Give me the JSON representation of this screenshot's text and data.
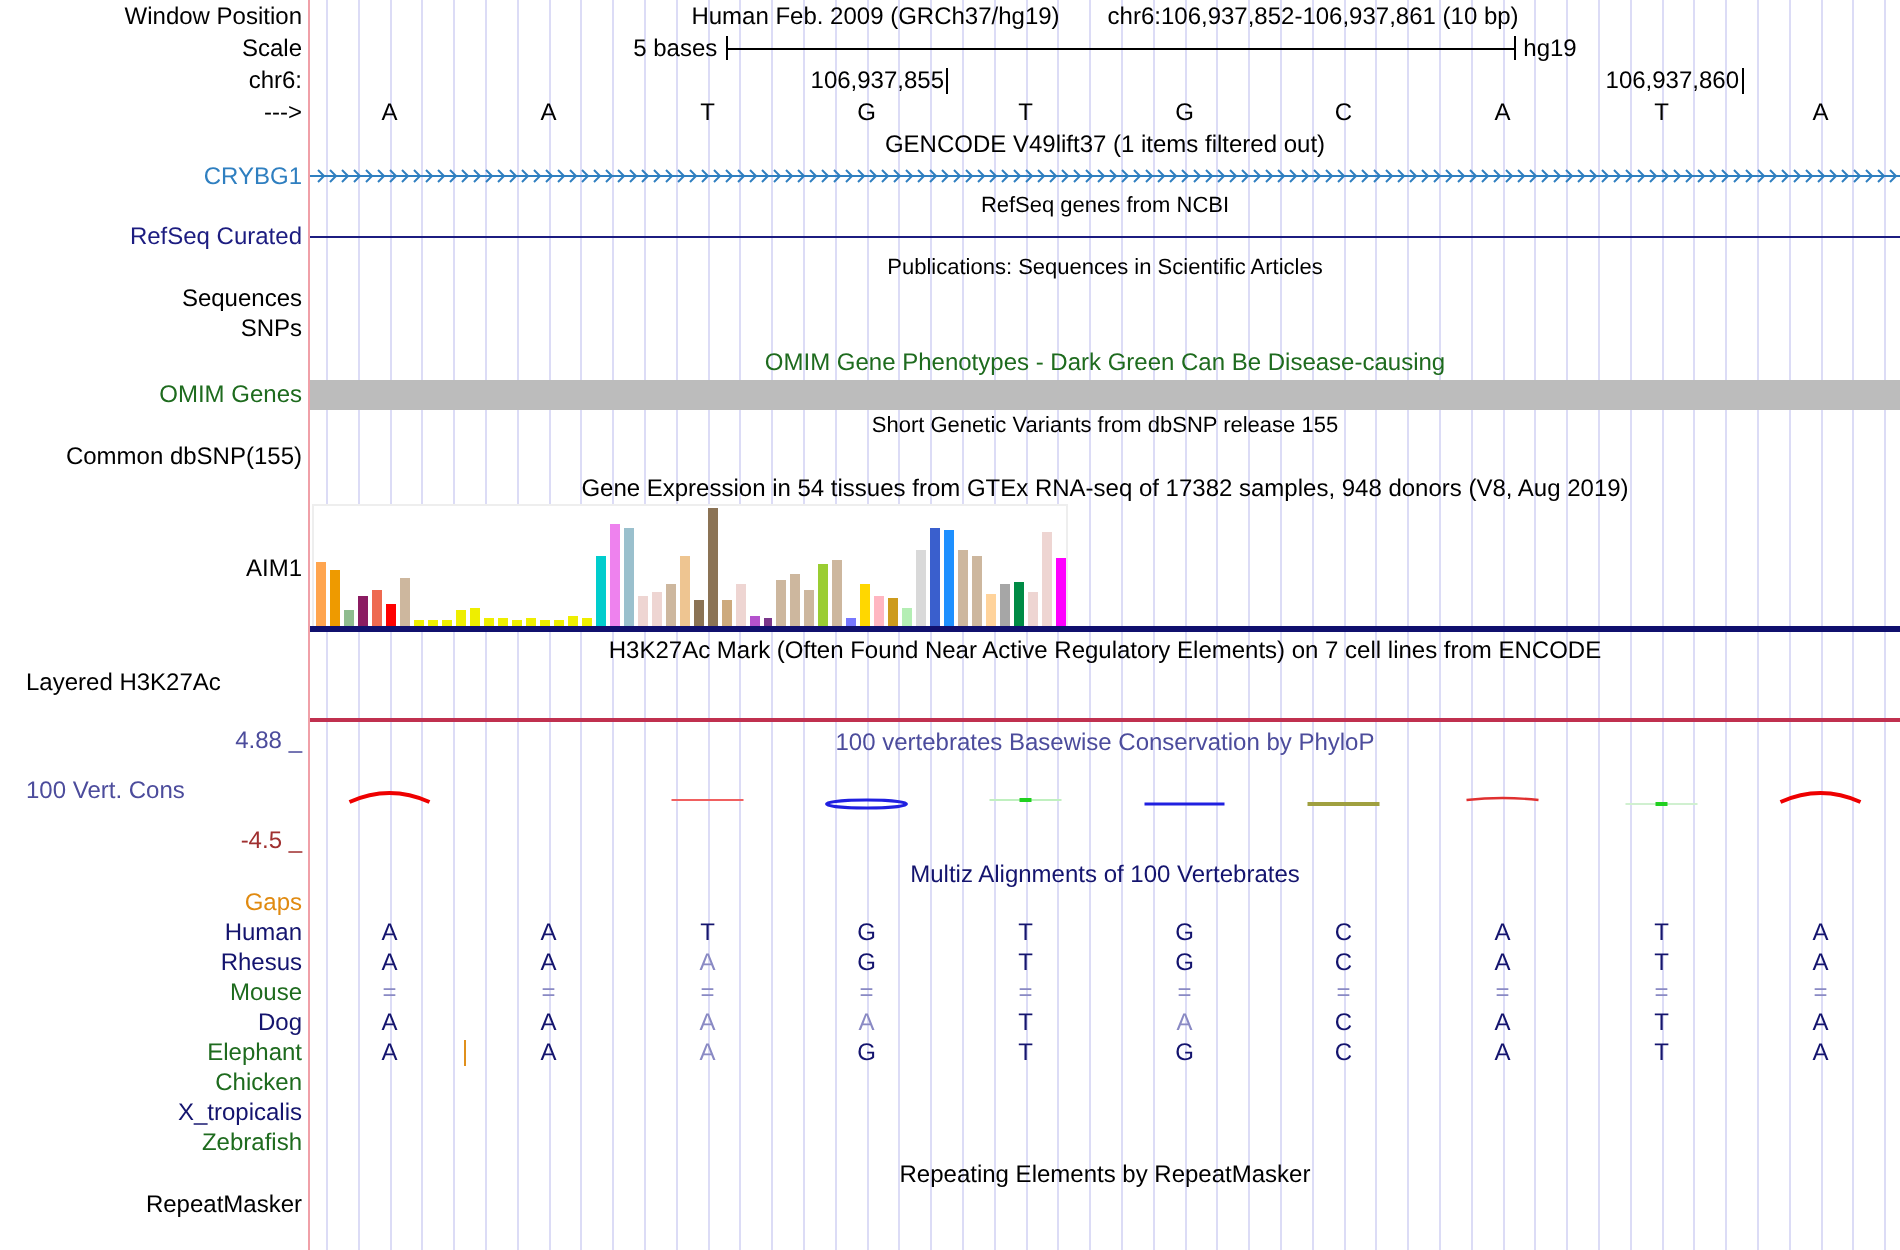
{
  "ruler": {
    "label": "Window Position",
    "assembly": "Human Feb. 2009 (GRCh37/hg19)",
    "position": "chr6:106,937,852-106,937,861 (10 bp)",
    "scale_label": "Scale",
    "scale_length": "5 bases",
    "scale_db": "hg19",
    "chrom_label": "chr6:",
    "ticks": [
      "106,937,855",
      "106,937,860"
    ],
    "strand_label": "--->",
    "bases": [
      "A",
      "A",
      "T",
      "G",
      "T",
      "G",
      "C",
      "A",
      "T",
      "A"
    ]
  },
  "tracks": [
    {
      "kind": "gene",
      "title": "GENCODE V49lift37 (1 items filtered out)",
      "labels": [
        "CRYBG1"
      ],
      "color": "#2f7fc0"
    },
    {
      "kind": "line",
      "title": "RefSeq genes from NCBI",
      "labels": [
        "RefSeq Curated"
      ],
      "color": "#1c1c80"
    },
    {
      "kind": "empty",
      "title": "Publications: Sequences in Scientific Articles",
      "labels": [
        "Sequences",
        "SNPs"
      ],
      "color": "#000000"
    },
    {
      "kind": "bar",
      "title": "OMIM Gene Phenotypes - Dark Green Can Be Disease-causing",
      "labels": [
        "OMIM Genes"
      ],
      "color": "#1e6b1e"
    },
    {
      "kind": "empty",
      "title": "Short Genetic Variants from dbSNP release 155",
      "labels": [
        "Common dbSNP(155)"
      ],
      "color": "#000000"
    },
    {
      "kind": "expression",
      "title": "Gene Expression in 54 tissues from GTEx RNA-seq of 17382 samples, 948 donors (V8, Aug 2019)",
      "labels": [
        "AIM1"
      ],
      "color": "#000000"
    },
    {
      "kind": "signal",
      "title": "H3K27Ac Mark (Often Found Near Active Regulatory Elements) on 7 cell lines from ENCODE",
      "labels": [
        "Layered H3K27Ac"
      ],
      "color": "#000000"
    },
    {
      "kind": "conservation",
      "title": "100 vertebrates Basewise Conservation by PhyloP",
      "labels": [
        "100 Vert. Cons"
      ],
      "color": "#4c4c9c",
      "scale_max": "4.88 _",
      "scale_min": "-4.5 _"
    },
    {
      "kind": "alignment",
      "title": "Multiz Alignments of 100 Vertebrates",
      "gaps_label": "Gaps",
      "species": [
        {
          "name": "Human",
          "color": "#14146e",
          "bases": [
            "A",
            "A",
            "T",
            "G",
            "T",
            "G",
            "C",
            "A",
            "T",
            "A"
          ],
          "dim": [
            false,
            false,
            false,
            false,
            false,
            false,
            false,
            false,
            false,
            false
          ]
        },
        {
          "name": "Rhesus",
          "color": "#14146e",
          "bases": [
            "A",
            "A",
            "A",
            "G",
            "T",
            "G",
            "C",
            "A",
            "T",
            "A"
          ],
          "dim": [
            false,
            false,
            true,
            false,
            false,
            false,
            false,
            false,
            false,
            false
          ]
        },
        {
          "name": "Mouse",
          "color": "#1e6b1e",
          "bases": [
            "=",
            "=",
            "=",
            "=",
            "=",
            "=",
            "=",
            "=",
            "=",
            "="
          ],
          "dim": [
            true,
            true,
            true,
            true,
            true,
            true,
            true,
            true,
            true,
            true
          ]
        },
        {
          "name": "Dog",
          "color": "#14146e",
          "bases": [
            "A",
            "A",
            "A",
            "A",
            "T",
            "A",
            "C",
            "A",
            "T",
            "A"
          ],
          "dim": [
            false,
            false,
            true,
            true,
            false,
            true,
            false,
            false,
            false,
            false
          ]
        },
        {
          "name": "Elephant",
          "color": "#1e6b1e",
          "bases": [
            "A",
            "A",
            "A",
            "G",
            "T",
            "G",
            "C",
            "A",
            "T",
            "A"
          ],
          "dim": [
            false,
            false,
            true,
            false,
            false,
            false,
            false,
            false,
            false,
            false
          ],
          "insert_after": [
            true,
            false,
            false,
            false,
            false,
            false,
            false,
            false,
            false,
            false
          ]
        },
        {
          "name": "Chicken",
          "color": "#1e6b1e"
        },
        {
          "name": "X_tropicalis",
          "color": "#14146e"
        },
        {
          "name": "Zebrafish",
          "color": "#1e6b1e"
        }
      ]
    },
    {
      "kind": "empty",
      "title": "Repeating Elements by RepeatMasker",
      "labels": [
        "RepeatMasker"
      ],
      "color": "#000000"
    }
  ]
}
